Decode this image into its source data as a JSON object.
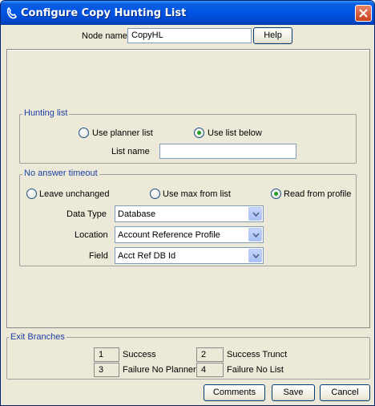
{
  "window": {
    "title": "Configure Copy Hunting List"
  },
  "node": {
    "label": "Node name",
    "value": "CopyHL",
    "help_label": "Help"
  },
  "hunting": {
    "legend": "Hunting list",
    "radio_planner": "Use planner list",
    "radio_below": "Use list below",
    "selected": "Use list below",
    "list_name_label": "List name",
    "list_name_value": ""
  },
  "timeout": {
    "legend": "No answer timeout",
    "radio_leave": "Leave unchanged",
    "radio_max": "Use max from list",
    "radio_profile": "Read from profile",
    "selected": "Read from profile",
    "data_type_label": "Data Type",
    "data_type_value": "Database",
    "location_label": "Location",
    "location_value": "Account Reference Profile",
    "field_label": "Field",
    "field_value": "Acct Ref DB Id"
  },
  "exits": {
    "legend": "Exit Branches",
    "items": [
      {
        "num": "1",
        "label": "Success"
      },
      {
        "num": "2",
        "label": "Success Trunct"
      },
      {
        "num": "3",
        "label": "Failure No Planner"
      },
      {
        "num": "4",
        "label": "Failure No List"
      }
    ]
  },
  "footer": {
    "comments_label": "Comments",
    "save_label": "Save",
    "cancel_label": "Cancel"
  }
}
